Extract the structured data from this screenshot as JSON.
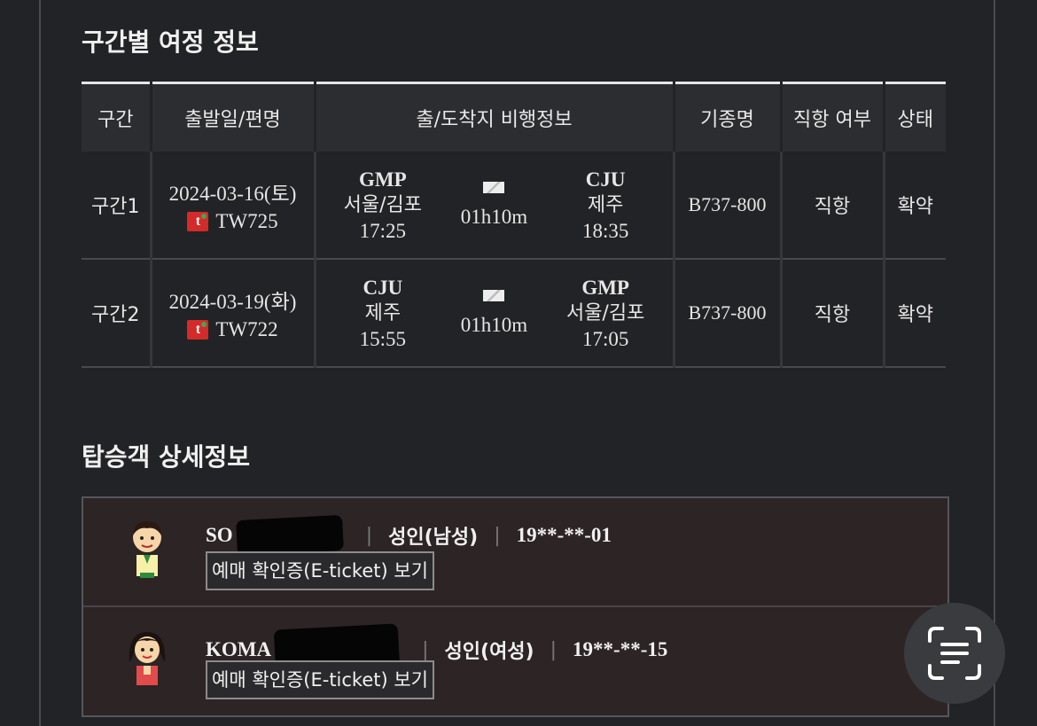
{
  "itinerary": {
    "title": "구간별 여정 정보",
    "headers": [
      "구간",
      "출발일/편명",
      "출/도착지 비행정보",
      "기종명",
      "직항 여부",
      "상태"
    ],
    "segments": [
      {
        "segment": "구간1",
        "date": "2024-03-16(토)",
        "flight": "TW725",
        "dep_code": "GMP",
        "dep_city": "서울/김포",
        "dep_time": "17:25",
        "duration": "01h10m",
        "arr_code": "CJU",
        "arr_city": "제주",
        "arr_time": "18:35",
        "aircraft": "B737-800",
        "direct": "직항",
        "status": "확약"
      },
      {
        "segment": "구간2",
        "date": "2024-03-19(화)",
        "flight": "TW722",
        "dep_code": "CJU",
        "dep_city": "제주",
        "dep_time": "15:55",
        "duration": "01h10m",
        "arr_code": "GMP",
        "arr_city": "서울/김포",
        "arr_time": "17:05",
        "aircraft": "B737-800",
        "direct": "직항",
        "status": "확약"
      }
    ]
  },
  "passengers": {
    "title": "탑승객 상세정보",
    "list": [
      {
        "name": "SO",
        "type": "성인(남성)",
        "dob": "19**-**-01",
        "eticket_label": "예매 확인증(E-ticket) 보기"
      },
      {
        "name": "KOMA",
        "type": "성인(여성)",
        "dob": "19**-**-15",
        "eticket_label": "예매 확인증(E-ticket) 보기"
      }
    ]
  },
  "airline_logo_text": "t",
  "colors": {
    "background": "#222326",
    "header_bg": "#2c2d31",
    "pax_bg": "#2d2425",
    "logo_red": "#d42a2a"
  },
  "icons": [
    "airplane-icon",
    "male-avatar-icon",
    "female-avatar-icon",
    "text-scan-icon"
  ]
}
